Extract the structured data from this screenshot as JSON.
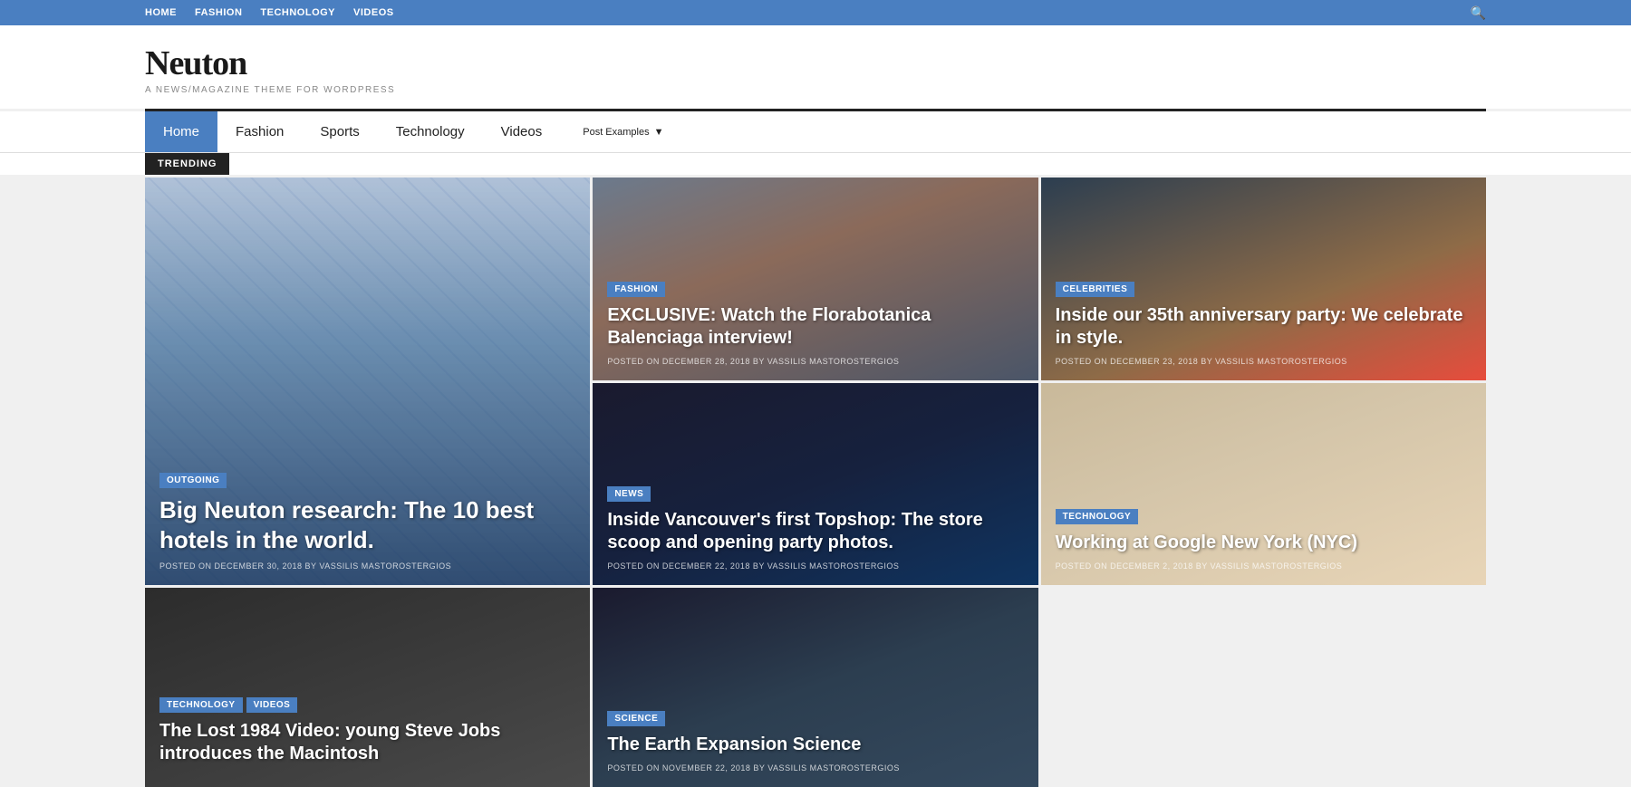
{
  "topbar": {
    "nav": [
      {
        "label": "HOME",
        "href": "#"
      },
      {
        "label": "FASHION",
        "href": "#"
      },
      {
        "label": "TECHNOLOGY",
        "href": "#"
      },
      {
        "label": "VIDEOS",
        "href": "#"
      }
    ],
    "search_icon": "🔍"
  },
  "header": {
    "title": "Neuton",
    "subtitle": "A NEWS/MAGAZINE THEME FOR WORDPRESS"
  },
  "mainnav": {
    "items": [
      {
        "label": "Home",
        "active": true
      },
      {
        "label": "Fashion",
        "active": false
      },
      {
        "label": "Sports",
        "active": false
      },
      {
        "label": "Technology",
        "active": false
      },
      {
        "label": "Videos",
        "active": false
      },
      {
        "label": "Post Examples",
        "dropdown": true,
        "active": false
      }
    ]
  },
  "trending": {
    "label": "TRENDING"
  },
  "cards": [
    {
      "id": "hotel",
      "span": "tall",
      "badge": "OUTGOING",
      "title": "Big Neuton research: The 10 best hotels in the world.",
      "meta": "POSTED ON DECEMBER 30, 2018 BY VASSILIS MASTOROSTERGIOS",
      "bg": "hotel"
    },
    {
      "id": "fashion",
      "span": "normal",
      "badge": "FASHION",
      "title": "EXCLUSIVE: Watch the Florabotanica Balenciaga interview!",
      "meta": "POSTED ON DECEMBER 28, 2018 BY VASSILIS MASTOROSTERGIOS",
      "bg": "fashion"
    },
    {
      "id": "celebrities",
      "span": "normal",
      "badge": "CELEBRITIES",
      "title": "Inside our 35th anniversary party: We celebrate in style.",
      "meta": "POSTED ON DECEMBER 23, 2018 BY VASSILIS MASTOROSTERGIOS",
      "bg": "celebrities"
    },
    {
      "id": "topshop",
      "span": "normal",
      "badge": "NEWS",
      "title": "Inside Vancouver's first Topshop: The store scoop and opening party photos.",
      "meta": "POSTED ON DECEMBER 22, 2018 BY VASSILIS MASTOROSTERGIOS",
      "bg": "topshop"
    },
    {
      "id": "google",
      "span": "normal",
      "badge": "TECHNOLOGY",
      "title": "Working at Google New York (NYC)",
      "meta": "POSTED ON DECEMBER 2, 2018 BY VASSILIS MASTOROSTERGIOS",
      "bg": "google"
    },
    {
      "id": "jobs",
      "span": "normal",
      "badges": [
        "TECHNOLOGY",
        "VIDEOS"
      ],
      "title": "The Lost 1984 Video: young Steve Jobs introduces the Macintosh",
      "meta": "",
      "bg": "jobs"
    },
    {
      "id": "science",
      "span": "normal",
      "badge": "SCIENCE",
      "title": "The Earth Expansion Science",
      "meta": "POSTED ON NOVEMBER 22, 2018 BY VASSILIS MASTOROSTERGIOS",
      "bg": "science"
    }
  ]
}
